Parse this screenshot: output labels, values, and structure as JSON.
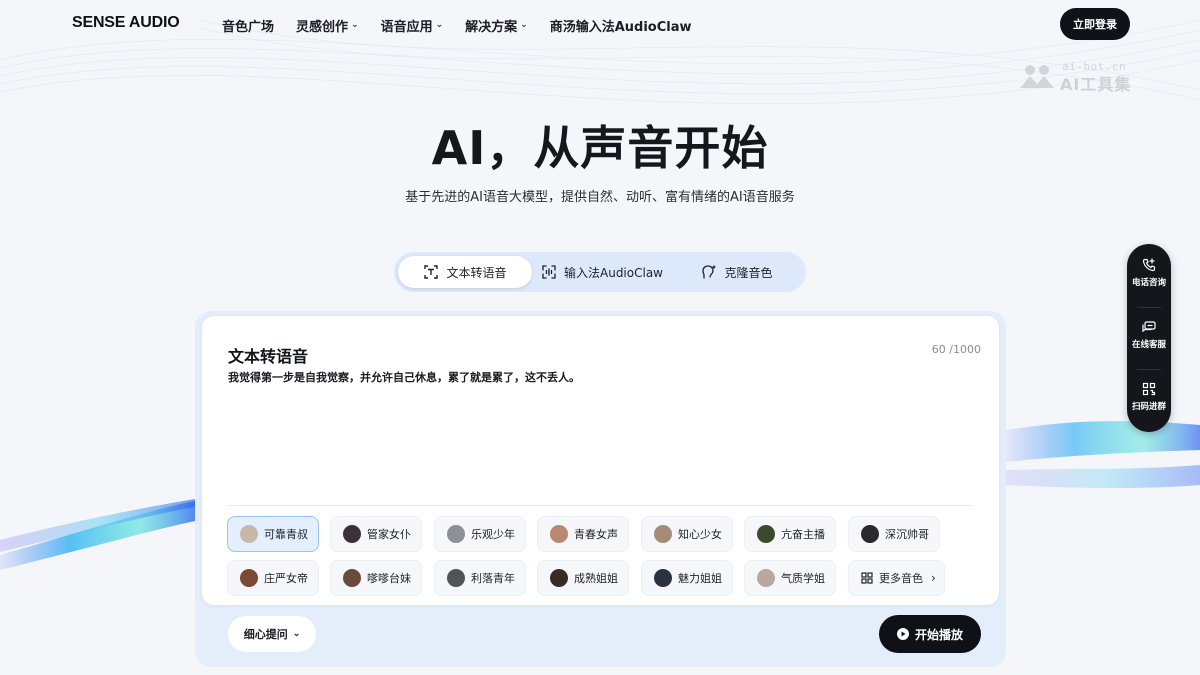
{
  "nav": {
    "logo": "SENSE AUDIO",
    "items": [
      {
        "label": "音色广场",
        "dropdown": false
      },
      {
        "label": "灵感创作",
        "dropdown": true
      },
      {
        "label": "语音应用",
        "dropdown": true
      },
      {
        "label": "解决方案",
        "dropdown": true
      },
      {
        "label": "商汤输入法AudioClaw",
        "dropdown": false
      }
    ],
    "login_label": "立即登录"
  },
  "watermark": {
    "url": "ai-bot.cn",
    "name": "AI工具集"
  },
  "hero": {
    "title": "AI，从声音开始",
    "subtitle": "基于先进的AI语音大模型，提供自然、动听、富有情绪的AI语音服务"
  },
  "tabs": [
    {
      "label": "文本转语音",
      "icon": "text-t-icon",
      "active": true
    },
    {
      "label": "输入法AudioClaw",
      "icon": "waveform-icon",
      "active": false
    },
    {
      "label": "克隆音色",
      "icon": "voice-clone-icon",
      "active": false
    }
  ],
  "editor": {
    "title": "文本转语音",
    "count": "60 /1000",
    "text": "我觉得第一步是自我觉察，并允许自己休息，累了就是累了，这不丢人。"
  },
  "voices": [
    {
      "label": "可靠青叔",
      "selected": true,
      "avatar_color": "#c9b8a8"
    },
    {
      "label": "管家女仆",
      "selected": false,
      "avatar_color": "#3a3236"
    },
    {
      "label": "乐观少年",
      "selected": false,
      "avatar_color": "#8c9098"
    },
    {
      "label": "青春女声",
      "selected": false,
      "avatar_color": "#b88870"
    },
    {
      "label": "知心少女",
      "selected": false,
      "avatar_color": "#a68a78"
    },
    {
      "label": "亢奋主播",
      "selected": false,
      "avatar_color": "#3c4a2c"
    },
    {
      "label": "深沉帅哥",
      "selected": false,
      "avatar_color": "#2a2a2e"
    },
    {
      "label": "庄严女帝",
      "selected": false,
      "avatar_color": "#7a4a34"
    },
    {
      "label": "嗲嗲台妹",
      "selected": false,
      "avatar_color": "#6a4a3c"
    },
    {
      "label": "利落青年",
      "selected": false,
      "avatar_color": "#505358"
    },
    {
      "label": "成熟姐姐",
      "selected": false,
      "avatar_color": "#3a2a26"
    },
    {
      "label": "魅力姐姐",
      "selected": false,
      "avatar_color": "#2c3240"
    },
    {
      "label": "气质学姐",
      "selected": false,
      "avatar_color": "#b8a8a0"
    }
  ],
  "more_voices_label": "更多音色",
  "tips_label": "细心提问",
  "play_label": "开始播放",
  "side": [
    {
      "label": "电话咨询",
      "icon": "phone-icon"
    },
    {
      "label": "在线客服",
      "icon": "chat-icon"
    },
    {
      "label": "扫码进群",
      "icon": "qr-code-icon"
    }
  ]
}
